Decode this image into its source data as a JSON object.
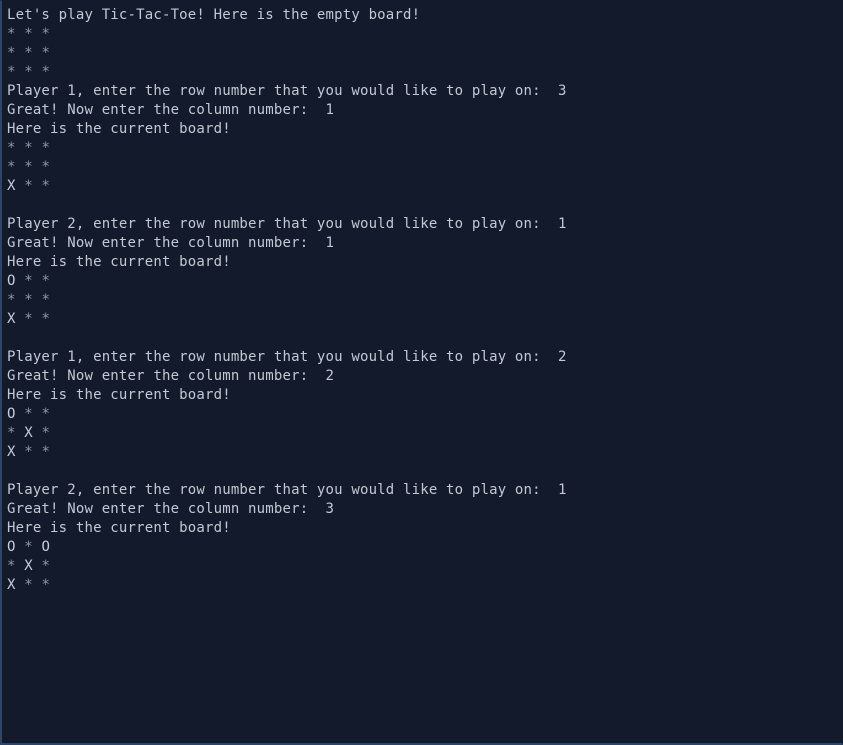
{
  "terminal": {
    "background_color": "#131a2c",
    "text_color": "#c3c8d2",
    "dim_color": "#8f97a8",
    "border_color": "#2e4468"
  },
  "strings": {
    "intro": "Let's play Tic-Tac-Toe! Here is the empty board!",
    "current_board": "Here is the current board!",
    "row_prompt_p1": "Player 1, enter the row number that you would like to play on:  ",
    "row_prompt_p2": "Player 2, enter the row number that you would like to play on:  ",
    "col_prompt": "Great! Now enter the column number:  ",
    "empty_cell": "*",
    "mark_x": "X",
    "mark_o": "O"
  },
  "transcript": [
    {
      "kind": "text",
      "id": "intro-line",
      "text": "Let's play Tic-Tac-Toe! Here is the empty board!"
    },
    {
      "kind": "board",
      "id": "board-empty",
      "rows": [
        [
          "*",
          "*",
          "*"
        ],
        [
          "*",
          "*",
          "*"
        ],
        [
          "*",
          "*",
          "*"
        ]
      ]
    },
    {
      "kind": "prompt",
      "id": "row-prompt-1",
      "label": "Player 1, enter the row number that you would like to play on:  ",
      "value": "3"
    },
    {
      "kind": "prompt",
      "id": "col-prompt-1",
      "label": "Great! Now enter the column number:  ",
      "value": "1"
    },
    {
      "kind": "text",
      "id": "board-header-1",
      "text": "Here is the current board!"
    },
    {
      "kind": "board",
      "id": "board-state-1",
      "rows": [
        [
          "*",
          "*",
          "*"
        ],
        [
          "*",
          "*",
          "*"
        ],
        [
          "X",
          "*",
          "*"
        ]
      ]
    },
    {
      "kind": "blank",
      "id": "spacer-1"
    },
    {
      "kind": "prompt",
      "id": "row-prompt-2",
      "label": "Player 2, enter the row number that you would like to play on:  ",
      "value": "1"
    },
    {
      "kind": "prompt",
      "id": "col-prompt-2",
      "label": "Great! Now enter the column number:  ",
      "value": "1"
    },
    {
      "kind": "text",
      "id": "board-header-2",
      "text": "Here is the current board!"
    },
    {
      "kind": "board",
      "id": "board-state-2",
      "rows": [
        [
          "O",
          "*",
          "*"
        ],
        [
          "*",
          "*",
          "*"
        ],
        [
          "X",
          "*",
          "*"
        ]
      ]
    },
    {
      "kind": "blank",
      "id": "spacer-2"
    },
    {
      "kind": "prompt",
      "id": "row-prompt-3",
      "label": "Player 1, enter the row number that you would like to play on:  ",
      "value": "2"
    },
    {
      "kind": "prompt",
      "id": "col-prompt-3",
      "label": "Great! Now enter the column number:  ",
      "value": "2"
    },
    {
      "kind": "text",
      "id": "board-header-3",
      "text": "Here is the current board!"
    },
    {
      "kind": "board",
      "id": "board-state-3",
      "rows": [
        [
          "O",
          "*",
          "*"
        ],
        [
          "*",
          "X",
          "*"
        ],
        [
          "X",
          "*",
          "*"
        ]
      ]
    },
    {
      "kind": "blank",
      "id": "spacer-3"
    },
    {
      "kind": "prompt",
      "id": "row-prompt-4",
      "label": "Player 2, enter the row number that you would like to play on:  ",
      "value": "1"
    },
    {
      "kind": "prompt",
      "id": "col-prompt-4",
      "label": "Great! Now enter the column number:  ",
      "value": "3"
    },
    {
      "kind": "text",
      "id": "board-header-4",
      "text": "Here is the current board!"
    },
    {
      "kind": "board",
      "id": "board-state-4",
      "rows": [
        [
          "O",
          "*",
          "O"
        ],
        [
          "*",
          "X",
          "*"
        ],
        [
          "X",
          "*",
          "*"
        ]
      ]
    }
  ],
  "game_state": {
    "moves": [
      {
        "player": 1,
        "mark": "X",
        "row": "3",
        "col": "1"
      },
      {
        "player": 2,
        "mark": "O",
        "row": "1",
        "col": "1"
      },
      {
        "player": 1,
        "mark": "X",
        "row": "2",
        "col": "2"
      },
      {
        "player": 2,
        "mark": "O",
        "row": "1",
        "col": "3"
      }
    ],
    "final_board": [
      [
        "O",
        "*",
        "O"
      ],
      [
        "*",
        "X",
        "*"
      ],
      [
        "X",
        "*",
        "*"
      ]
    ]
  }
}
